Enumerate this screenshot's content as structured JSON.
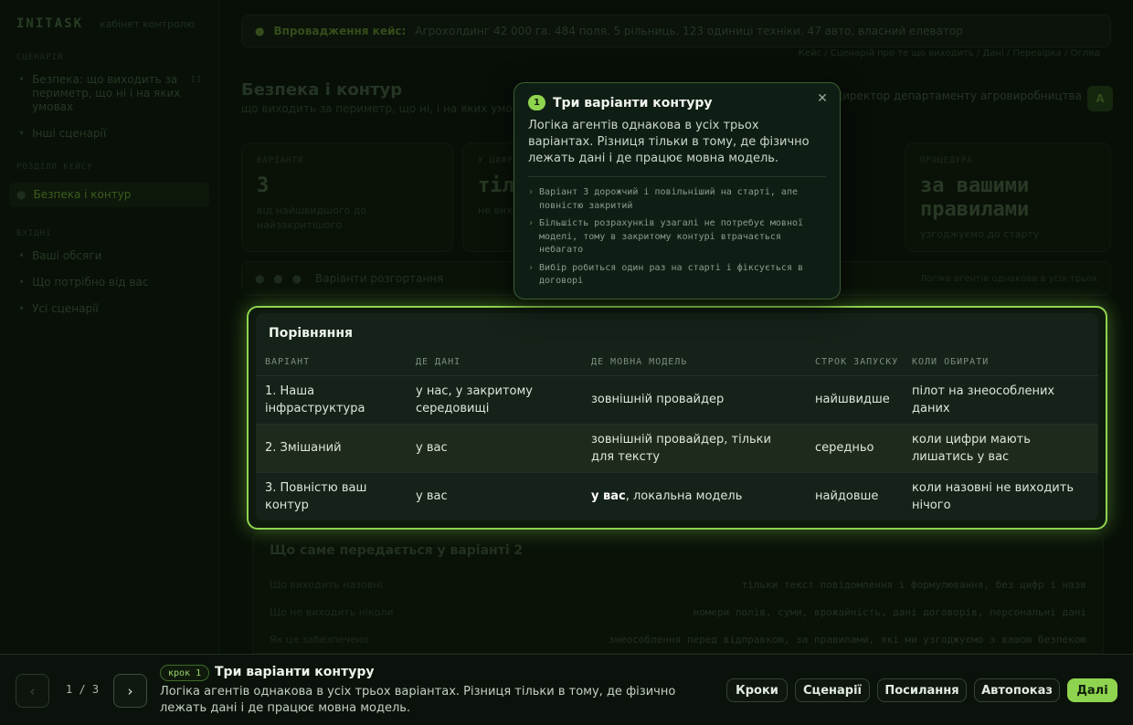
{
  "sidebar": {
    "brand": "INITASK",
    "brand_sub": "кабінет контролю",
    "section1": "Сценарій",
    "items1": [
      {
        "label": "Безпека: що виходить за периметр, що ні і на яких умовах",
        "count": "11"
      },
      {
        "label": "Інші сценарії"
      }
    ],
    "section2": "Розділи кейсу",
    "active_item": "Безпека і контур",
    "section3": "Вхідні",
    "items3": [
      "Ваші обсяги",
      "Що потрібно від вас",
      "Усі сценарії"
    ]
  },
  "main": {
    "banner_label": "Впровадження кейс:",
    "banner_text": "Агрохолдинг 42 000 га. 484 поля. 5 рільниць. 123 одиниці техніки. 47 авто, власний елеватор",
    "crumbs": "Кейс / Сценарій про те що виходить / Дані / Перевірка / Огляд",
    "title": "Безпека і контур",
    "subtitle": "що виходить за периметр, що ні, і на яких умовах",
    "owner": "Директор департаменту агровиробництва",
    "owner_initial": "А",
    "kpis": [
      {
        "label": "Варіанти",
        "value": "3",
        "note": "від найшвидшого до найзакритішого"
      },
      {
        "label": "У цифрах",
        "value": "тіл",
        "note": "не виходить"
      },
      {
        "label": "Процедура",
        "value": "за вашими правилами",
        "note": "узгоджуємо до старту"
      }
    ],
    "variants_bar": "Варіанти розгортання",
    "variants_bar_right": "Логіка агентів однакова в усіх трьох",
    "detail": {
      "title": "Що саме передається у варіанті 2",
      "rows": [
        {
          "l": "Що виходить назовні",
          "r": "тільки текст повідомлення і формулювання, без цифр і назв"
        },
        {
          "l": "Що не виходить ніколи",
          "r": "номери полів, суми, врожайність, дані договорів, персональні дані"
        },
        {
          "l": "Як це забезпечено",
          "r": "знеособлення перед відправкою, за правилами, які ми узгоджуємо з вашою безпекою"
        }
      ]
    }
  },
  "compare": {
    "title": "Порівняння",
    "headers": [
      "ВАРІАНТ",
      "ДЕ ДАНІ",
      "ДЕ МОВНА МОДЕЛЬ",
      "СТРОК ЗАПУСКУ",
      "КОЛИ ОБИРАТИ"
    ],
    "rows": [
      [
        "1. Наша інфраструктура",
        "у нас, у закритому середовищі",
        "зовнішній провайдер",
        "найшвидше",
        "пілот на знеособлених даних"
      ],
      [
        "2. Змішаний",
        "у вас",
        "зовнішній провайдер, тільки для тексту",
        "середньо",
        "коли цифри мають лишатись у вас"
      ],
      [
        "3. Повністю ваш контур",
        "у вас",
        "",
        "найдовше",
        "коли назовні не виходить нічого"
      ]
    ],
    "row3_model_bold": "у вас",
    "row3_model_rest": ", локальна модель"
  },
  "popover": {
    "num": "1",
    "title": "Три варіанти контуру",
    "body": "Логіка агентів однакова в усіх трьох варіантах. Різниця тільки в тому, де фізично лежать дані і де працює мовна модель.",
    "bullets": [
      "Варіант 3 дорожчий і повільніший на старті, але повністю закритий",
      "Більшість розрахунків узагалі не потребує мовної моделі, тому в закритому контурі втрачається небагато",
      "Вибір робиться один раз на старті і фіксується в договорі"
    ]
  },
  "bottombar": {
    "pager": "1 / 3",
    "step_badge": "крок 1",
    "step_title": "Три варіанти контуру",
    "step_desc": "Логіка агентів однакова в усіх трьох варіантах. Різниця тільки в тому, де фізично лежать дані і де працює мовна модель.",
    "buttons": [
      "Кроки",
      "Сценарії",
      "Посилання",
      "Автопоказ",
      "Далі"
    ]
  }
}
